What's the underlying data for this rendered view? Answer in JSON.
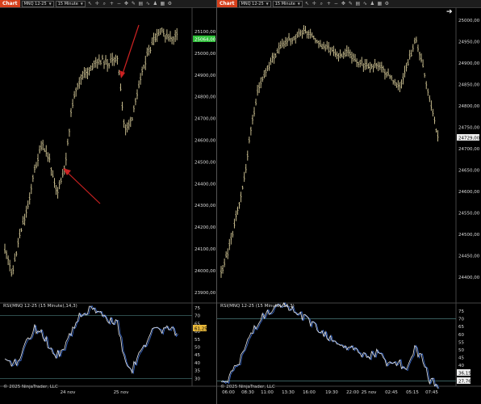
{
  "left": {
    "tab_label": "Chart",
    "instrument": "MNQ 12-25",
    "interval": "15 Minute",
    "toolbar_icons": [
      "pointer-icon",
      "crosshair-icon",
      "zoom-icon",
      "zoom-in-icon",
      "zoom-out-icon",
      "pan-icon",
      "draw-icon",
      "properties-icon",
      "indicators-icon",
      "strategies-icon",
      "data-box-icon",
      "settings-icon"
    ],
    "price_ticks": [
      "25100,00",
      "25000,00",
      "24900,00",
      "24800,00",
      "24700,00",
      "24600,00",
      "24500,00",
      "24400,00",
      "24300,00",
      "24200,00",
      "24100,00",
      "24000,00",
      "23900,00"
    ],
    "last_price": "25064,00",
    "rsi_label": "RSI(MNQ 12-25 (15 Minute),14,3)",
    "rsi_ticks": [
      "75",
      "70",
      "65",
      "60",
      "55",
      "50",
      "45",
      "40",
      "35",
      "30"
    ],
    "rsi_value": "61,25",
    "watermark": "© 2025 NinjaTrader, LLC",
    "time_ticks": [
      "24 nov",
      "25 nov"
    ]
  },
  "right": {
    "tab_label": "Chart",
    "instrument": "MNQ 12-25",
    "interval": "15 Minute",
    "toolbar_icons": [
      "pointer-icon",
      "crosshair-icon",
      "zoom-icon",
      "zoom-in-icon",
      "zoom-out-icon",
      "pan-icon",
      "draw-icon",
      "properties-icon",
      "indicators-icon",
      "strategies-icon",
      "data-box-icon",
      "settings-icon"
    ],
    "price_ticks": [
      "25000,00",
      "24950,00",
      "24900,00",
      "24850,00",
      "24800,00",
      "24750,00",
      "24700,00",
      "24650,00",
      "24600,00",
      "24550,00",
      "24500,00",
      "24450,00",
      "24400,00"
    ],
    "last_price": "24729,00",
    "rsi_label": "RSI(MNQ 12-25 (15 Minute),14,3)",
    "rsi_ticks": [
      "75",
      "70",
      "65",
      "60",
      "55",
      "50",
      "45",
      "40",
      "35",
      "30"
    ],
    "rsi_value_1": "36,15",
    "rsi_value_2": "27,76",
    "watermark": "© 2025 NinjaTrader, LLC",
    "time_ticks": [
      "06:00",
      "08:30",
      "11:00",
      "13:30",
      "16:00",
      "19:30",
      "22:00",
      "25 nov",
      "02:45",
      "05:15",
      "07:45"
    ]
  },
  "colors": {
    "bars": "#d8cc9a",
    "rsi_line": "#e6e6e6",
    "rsi_avg": "#3d6fd6",
    "last_price_tag": "#2fbf3a",
    "rsi_tag": "#e8b83a",
    "arrow": "#cc2222",
    "tab": "#d6401c"
  }
}
